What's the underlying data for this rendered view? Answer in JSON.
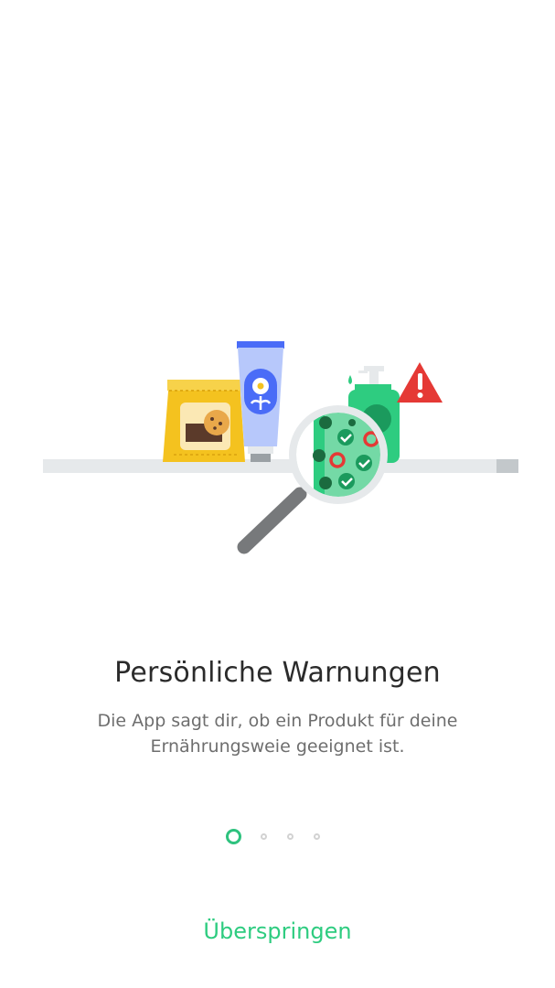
{
  "onboarding": {
    "title": "Persönliche Warnungen",
    "description": "Die App sagt dir, ob ein Produkt für deine Ernährungsweie geeignet ist.",
    "skip_label": "Überspringen",
    "pagination": {
      "total_pages": 4,
      "current_page": 1
    },
    "illustration_icons": [
      "cookie-package-icon",
      "cream-tube-icon",
      "soap-dispenser-icon",
      "warning-triangle-icon",
      "magnifying-glass-icon"
    ]
  },
  "colors": {
    "accent": "#2ecc80",
    "title": "#2b2b2b",
    "body_text": "#6e6e6e",
    "warning": "#e53935",
    "shelf": "#e6e9eb"
  }
}
